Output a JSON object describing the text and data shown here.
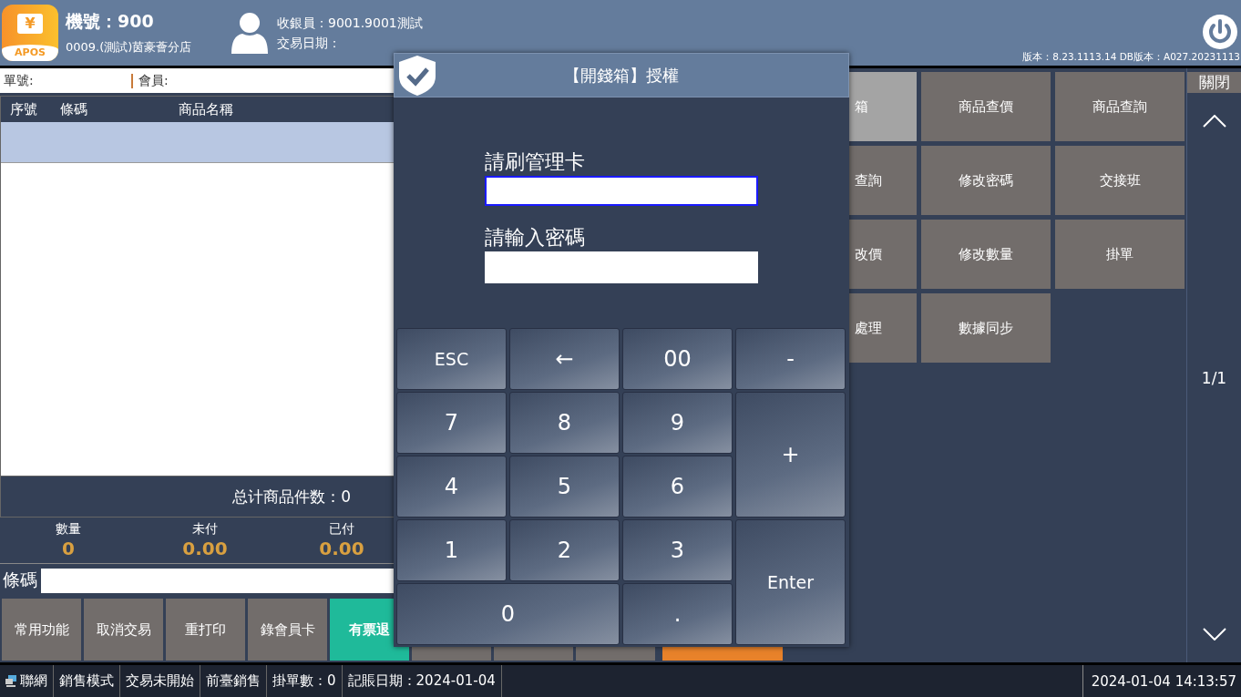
{
  "header": {
    "logo": {
      "symbol": "¥",
      "label": "APOS"
    },
    "machine": "機號：900",
    "store": "0009.(測試)茵豪薈分店",
    "cashier": "收銀員：9001.9001測試",
    "trade_date": "交易日期：",
    "version": "版本：8.23.1113.14 DB版本：A027.20231113"
  },
  "order_bar": {
    "order_label": "單號:",
    "member_label": "會員:"
  },
  "table": {
    "columns": [
      "序號",
      "條碼",
      "商品名稱"
    ],
    "rows": [
      {
        "selected": true
      }
    ]
  },
  "total_count": "总计商品件数：0",
  "summary": [
    {
      "label": "數量",
      "value": "0"
    },
    {
      "label": "未付",
      "value": "0.00"
    },
    {
      "label": "已付",
      "value": "0.00"
    }
  ],
  "barcode": {
    "label": "條碼"
  },
  "bottom_buttons": [
    {
      "label": "常用功能",
      "kind": "gray"
    },
    {
      "label": "取消交易",
      "kind": "gray"
    },
    {
      "label": "重打印",
      "kind": "gray"
    },
    {
      "label": "錄會員卡",
      "kind": "gray"
    },
    {
      "label": "有票退",
      "kind": "teal"
    },
    {
      "kind": "gray"
    },
    {
      "kind": "gray"
    },
    {
      "kind": "gray"
    },
    {
      "kind": "orange"
    }
  ],
  "function_buttons": [
    {
      "label": "箱",
      "selected": true
    },
    {
      "label": "商品查價",
      "selected": false
    },
    {
      "label": "商品查詢",
      "selected": false
    },
    {
      "label": "查詢",
      "selected": false
    },
    {
      "label": "修改密碼",
      "selected": false
    },
    {
      "label": "交接班",
      "selected": false
    },
    {
      "label": "改價",
      "selected": false
    },
    {
      "label": "修改數量",
      "selected": false
    },
    {
      "label": "掛單",
      "selected": false
    },
    {
      "label": "處理",
      "selected": false
    },
    {
      "label": "數據同步",
      "selected": false
    }
  ],
  "side_nav": {
    "close_label": "關閉",
    "page": "1/1"
  },
  "dialog": {
    "title": "【開錢箱】授權",
    "fields": [
      {
        "label": "請刷管理卡",
        "focused": true
      },
      {
        "label": "請輸入密碼",
        "focused": false
      }
    ],
    "keys": [
      {
        "label": "ESC",
        "kind": "normal"
      },
      {
        "label": "←",
        "kind": "normal"
      },
      {
        "label": "00",
        "kind": "normal"
      },
      {
        "label": "-",
        "kind": "normal"
      },
      {
        "label": "7",
        "kind": "normal"
      },
      {
        "label": "8",
        "kind": "normal"
      },
      {
        "label": "9",
        "kind": "normal"
      },
      {
        "label": "+",
        "kind": "tall"
      },
      {
        "label": "4",
        "kind": "normal"
      },
      {
        "label": "5",
        "kind": "normal"
      },
      {
        "label": "6",
        "kind": "normal"
      },
      {
        "label": "1",
        "kind": "normal"
      },
      {
        "label": "2",
        "kind": "normal"
      },
      {
        "label": "3",
        "kind": "normal"
      },
      {
        "label": "Enter",
        "kind": "tall"
      },
      {
        "label": "0",
        "kind": "wide"
      },
      {
        "label": ".",
        "kind": "normal"
      }
    ]
  },
  "status_bar": {
    "items": [
      "聯網",
      "銷售模式",
      "交易未開始",
      "前臺銷售",
      "掛單數：0",
      "記賬日期：2024-01-04"
    ],
    "datetime": "2024-01-04 14:13:57"
  }
}
